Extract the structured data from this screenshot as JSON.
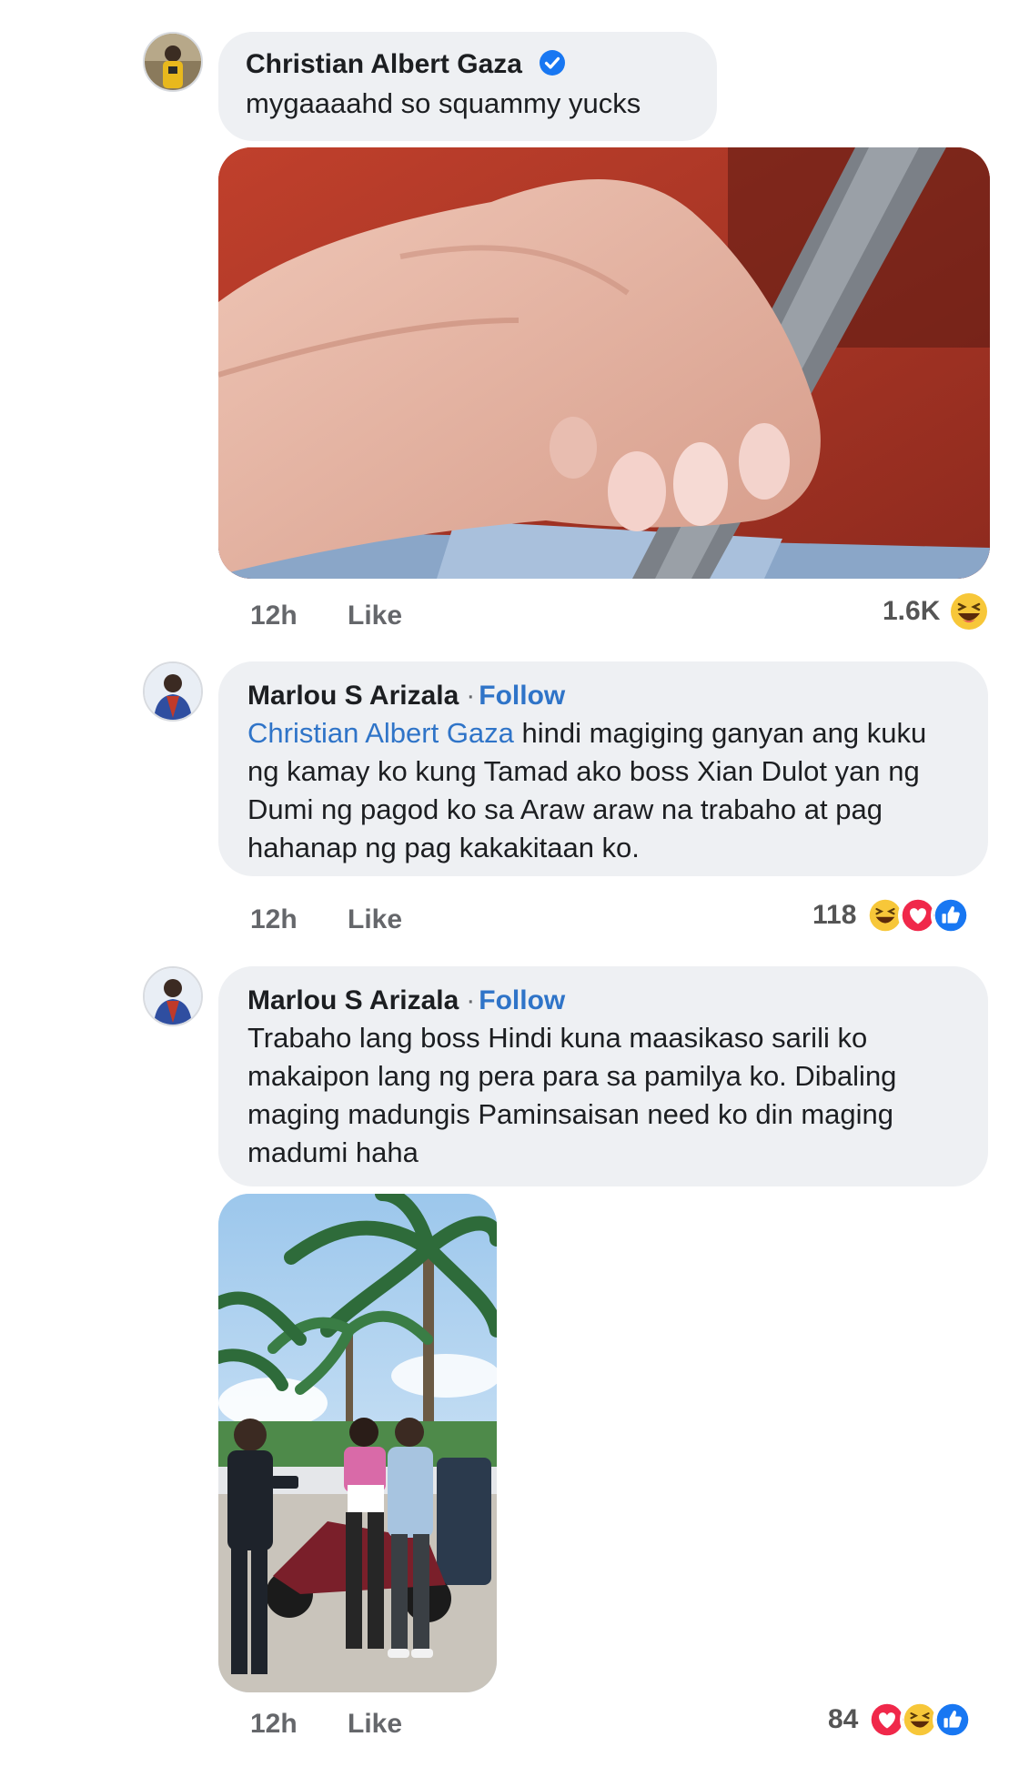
{
  "comments": [
    {
      "author": "Christian Albert Gaza",
      "verified": true,
      "text": "mygaaaahd so squammy yucks",
      "time": "12h",
      "like_label": "Like",
      "reaction_count": "1.6K",
      "reactions": [
        "haha"
      ]
    },
    {
      "author": "Marlou S Arizala",
      "separator": "·",
      "follow_label": "Follow",
      "mention": "Christian Albert Gaza",
      "text": "hindi magiging ganyan ang kuku ng kamay ko kung Tamad ako boss Xian Dulot yan ng Dumi ng pagod ko sa Araw araw na trabaho at pag hahanap ng pag kakakitaan ko.",
      "time": "12h",
      "like_label": "Like",
      "reaction_count": "118",
      "reactions": [
        "haha",
        "love",
        "like"
      ]
    },
    {
      "author": "Marlou S Arizala",
      "separator": "·",
      "follow_label": "Follow",
      "text": "Trabaho lang boss Hindi kuna maasikaso sarili ko makaipon lang ng pera para sa pamilya ko. Dibaling maging madungis Paminsaisan need ko din maging madumi haha",
      "time": "12h",
      "like_label": "Like",
      "reaction_count": "84",
      "reactions": [
        "love",
        "haha",
        "like"
      ]
    }
  ],
  "colors": {
    "link": "#2f74c8",
    "bubble": "#eef0f3",
    "like_blue": "#1877f2",
    "love_red": "#f0284a",
    "haha_yellow": "#f7c739"
  }
}
